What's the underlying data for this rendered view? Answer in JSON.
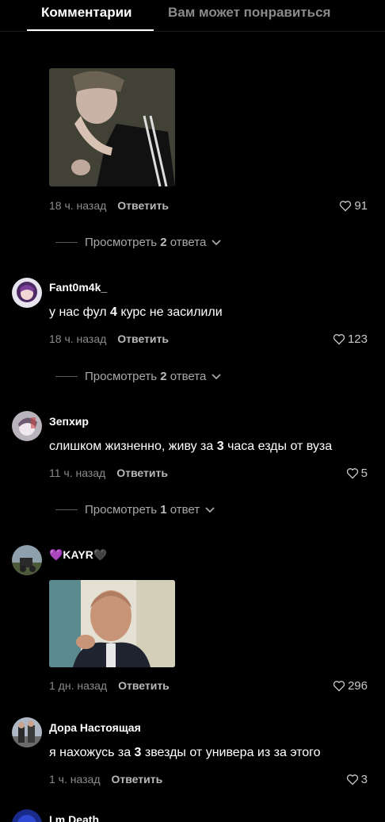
{
  "tabs": {
    "comments": "Комментарии",
    "recommended": "Вам может понравиться"
  },
  "comments": [
    {
      "time": "18 ч. назад",
      "reply": "Ответить",
      "likes": "91",
      "view_replies": {
        "prefix": "Просмотреть",
        "count": "2",
        "suffix": "ответа"
      }
    },
    {
      "username": "Fant0m4k_",
      "text_before": "у нас фул ",
      "text_bold": "4",
      "text_after": " курс не засилили",
      "time": "18 ч. назад",
      "reply": "Ответить",
      "likes": "123",
      "view_replies": {
        "prefix": "Просмотреть",
        "count": "2",
        "suffix": "ответа"
      }
    },
    {
      "username": "Зепхир",
      "text_before": "слишком жизненно, живу за ",
      "text_bold": "3",
      "text_after": " часа езды от вуза",
      "time": "11 ч. назад",
      "reply": "Ответить",
      "likes": "5",
      "view_replies": {
        "prefix": "Просмотреть",
        "count": "1",
        "suffix": "ответ"
      }
    },
    {
      "username": "💜KAYR🖤",
      "time": "1 дн. назад",
      "reply": "Ответить",
      "likes": "296"
    },
    {
      "username": "Дора Настоящая",
      "text_before": "я нахожусь за ",
      "text_bold": "3",
      "text_after": " звезды от универа из за этого",
      "time": "1 ч. назад",
      "reply": "Ответить",
      "likes": "3"
    },
    {
      "username": "I.m Death"
    }
  ]
}
